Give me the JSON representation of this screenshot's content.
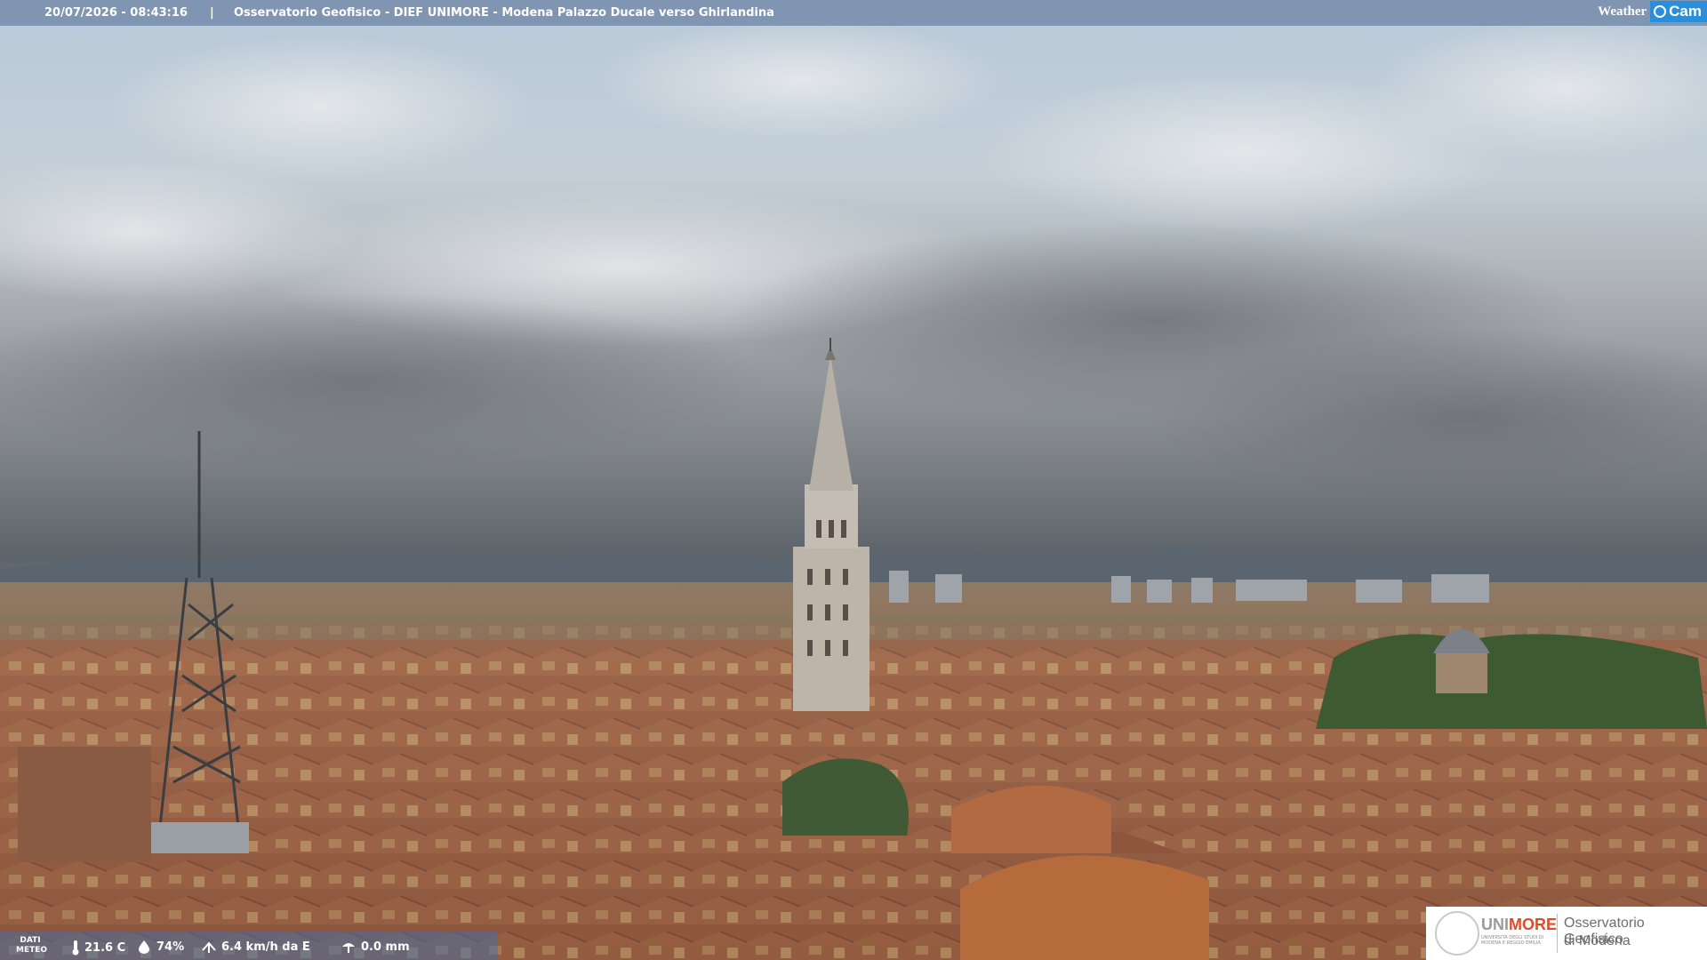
{
  "overlay": {
    "timestamp": "20/07/2026 - 08:43:16",
    "separator": "|",
    "title": "Osservatorio Geofisico - DIEF UNIMORE - Modena Palazzo Ducale verso Ghirlandina"
  },
  "brand": {
    "weather_label": "Weather",
    "cam_label": "Cam",
    "accent_color": "#2a8fd8"
  },
  "meteo": {
    "label_line1": "DATI",
    "label_line2": "METEO",
    "temperature": "21.6 C",
    "humidity": "74%",
    "wind": "6.4 km/h da E",
    "rain": "0.0 mm",
    "icons": [
      "thermometer-icon",
      "humidity-drop-icon",
      "wind-icon",
      "rain-gauge-icon"
    ]
  },
  "logo": {
    "unimore_part1": "UNI",
    "unimore_part2": "MORE",
    "unimore_sub": "UNIVERSITÀ DEGLI STUDI DI MODENA E REGGIO EMILIA",
    "observatory_line1": "Osservatorio Geofisico",
    "observatory_line2": "di Modena",
    "brand_color": "#e04b26"
  },
  "scene": {
    "description_colors": {
      "sky": "#aebccc",
      "clouds": "#8d9196",
      "roofs": "#a86a4a"
    }
  }
}
